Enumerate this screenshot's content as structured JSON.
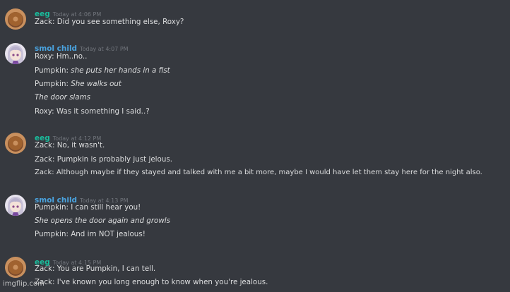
{
  "colors": {
    "background": "#36393f",
    "text": "#dcddde",
    "timestamp": "#72767d",
    "eeg_name": "#1abc9c",
    "smol_child_name": "#4aa3df"
  },
  "messages": [
    {
      "author": "eeg",
      "timestamp": "Today at 4:06 PM",
      "avatar": "donut-avatar-icon",
      "lines": [
        {
          "speaker": "Zack: ",
          "text": "Did you see something else, Roxy?",
          "italic": false
        }
      ]
    },
    {
      "author": "smol child",
      "timestamp": "Today at 4:07 PM",
      "avatar": "anime-girl-avatar-icon",
      "lines": [
        {
          "speaker": "Roxy: ",
          "text": "Hm..no..",
          "italic": false
        },
        {
          "speaker": "Pumpkin: ",
          "text": "she puts her hands in a fist",
          "italic": true
        },
        {
          "speaker": "Pumpkin: ",
          "text": "She walks out",
          "italic": true
        },
        {
          "speaker": "",
          "text": "The door slams",
          "italic": true
        },
        {
          "speaker": "Roxy: ",
          "text": "Was it something I said..?",
          "italic": false
        }
      ]
    },
    {
      "author": "eeg",
      "timestamp": "Today at 4:12 PM",
      "avatar": "donut-avatar-icon",
      "lines": [
        {
          "speaker": "Zack: ",
          "text": "No, it wasn't.",
          "italic": false
        },
        {
          "speaker": "Zack: ",
          "text": "Pumpkin is probably just jelous.",
          "italic": false
        },
        {
          "speaker": "Zack: ",
          "text": "Although maybe if they stayed and talked with me a bit more, maybe I would have let them stay here for the night also.",
          "italic": false
        }
      ]
    },
    {
      "author": "smol child",
      "timestamp": "Today at 4:13 PM",
      "avatar": "anime-girl-avatar-icon",
      "lines": [
        {
          "speaker": "Pumpkin: ",
          "text": "I can still hear you!",
          "italic": false
        },
        {
          "speaker": "",
          "text": "She opens the door again and growls",
          "italic": true
        },
        {
          "speaker": "Pumpkin: ",
          "text": "And im NOT jealous!",
          "italic": false
        }
      ]
    },
    {
      "author": "eeg",
      "timestamp": "Today at 4:15 PM",
      "avatar": "donut-avatar-icon",
      "lines": [
        {
          "speaker": "Zack: ",
          "text": "You are Pumpkin, I can tell.",
          "italic": false
        },
        {
          "speaker": "Zack: ",
          "text": "I've known you long enough to know when you're jealous.",
          "italic": false
        }
      ]
    }
  ],
  "watermark": "imgflip.com"
}
